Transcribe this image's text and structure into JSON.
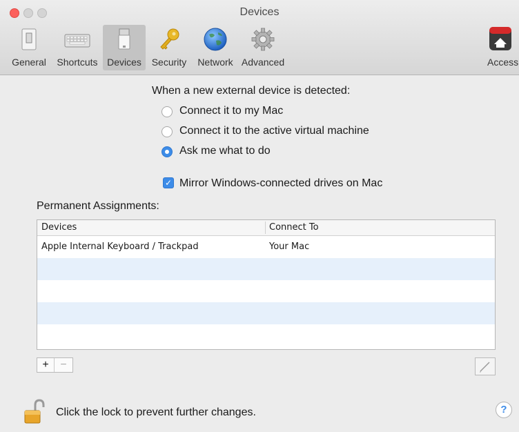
{
  "window": {
    "title": "Devices"
  },
  "toolbar": {
    "items": [
      {
        "label": "General",
        "icon": "general-switch-icon"
      },
      {
        "label": "Shortcuts",
        "icon": "keyboard-icon"
      },
      {
        "label": "Devices",
        "icon": "usb-device-icon",
        "selected": true
      },
      {
        "label": "Security",
        "icon": "key-icon"
      },
      {
        "label": "Network",
        "icon": "globe-icon"
      },
      {
        "label": "Advanced",
        "icon": "gear-icon"
      },
      {
        "label": "Access",
        "icon": "parallels-access-icon",
        "badge": "Parallels"
      }
    ]
  },
  "main": {
    "heading": "When a new external device is detected:",
    "options": [
      {
        "label": "Connect it to my Mac",
        "selected": false
      },
      {
        "label": "Connect it to the active virtual machine",
        "selected": false
      },
      {
        "label": "Ask me what to do",
        "selected": true
      }
    ],
    "mirror_checkbox": {
      "label": "Mirror Windows-connected drives on Mac",
      "checked": true
    },
    "permanent_label": "Permanent Assignments:",
    "table": {
      "columns": [
        "Devices",
        "Connect To"
      ],
      "rows": [
        {
          "device": "Apple Internal Keyboard / Trackpad",
          "connect_to": "Your Mac"
        }
      ]
    },
    "add_label": "+",
    "remove_label": "−"
  },
  "footer": {
    "lock_text": "Click the lock to prevent further changes.",
    "help_label": "?"
  },
  "colors": {
    "accent": "#3d8ce8",
    "selected_tab_bg": "#c3c3c3",
    "row_alt": "#e6f0fb"
  }
}
